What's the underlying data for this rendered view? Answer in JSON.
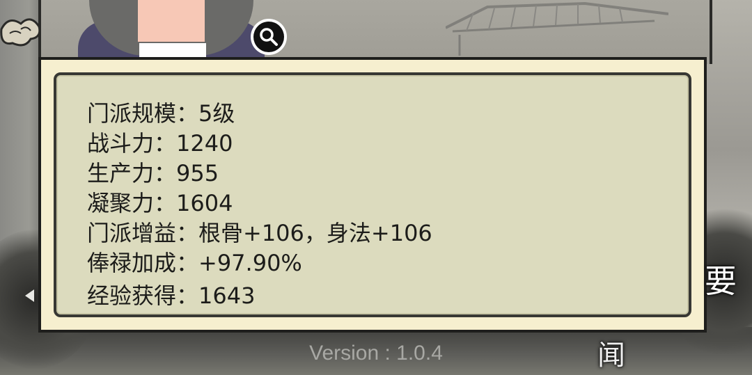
{
  "info_panel": {
    "lines": [
      "门派规模：5级",
      "战斗力：1240",
      "生产力：955",
      "凝聚力：1604",
      "门派增益：根骨+106，身法+106",
      "俸禄加成：+97.90%",
      "经验获得：1643"
    ]
  },
  "footer": {
    "version": "Version : 1.0.4"
  },
  "side_labels": {
    "right_char": "要",
    "bottom_char": "闻"
  },
  "icons": {
    "zoom": "magnifier-icon",
    "back": "left-arrow-icon"
  },
  "colors": {
    "panel_bg": "#dcdbbe",
    "panel_border": "#383834",
    "text": "#1c1c1a",
    "version_text": "#a8a8a4"
  }
}
